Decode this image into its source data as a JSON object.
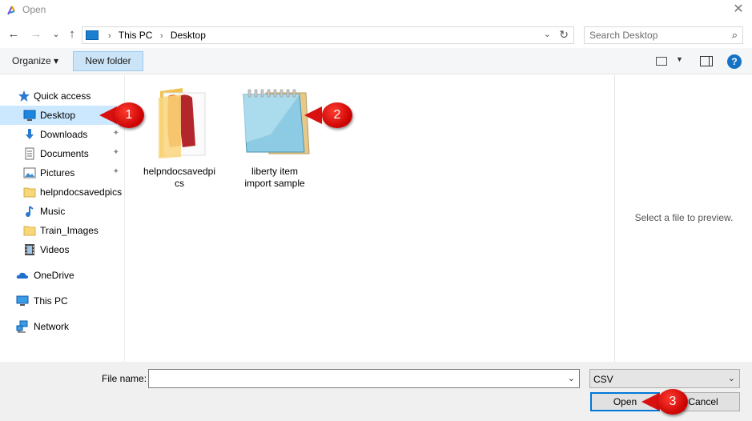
{
  "window": {
    "title": "Open",
    "close_glyph": "✕"
  },
  "navigation": {
    "back": "←",
    "forward": "→",
    "recent": "⌄",
    "up": "↑"
  },
  "address": {
    "breadcrumbs": [
      "This PC",
      "Desktop"
    ],
    "dropdown": "⌄",
    "refresh": "↻"
  },
  "search": {
    "placeholder": "Search Desktop"
  },
  "toolbar": {
    "organize_label": "Organize ▾",
    "new_folder_label": "New folder",
    "view_dropdown": "▼",
    "help": "?"
  },
  "sidebar": {
    "items": [
      {
        "label": "Quick access",
        "icon": "star-icon",
        "pinned": false
      },
      {
        "label": "Desktop",
        "icon": "desktop-icon",
        "pinned": true,
        "selected": true
      },
      {
        "label": "Downloads",
        "icon": "download-icon",
        "pinned": true
      },
      {
        "label": "Documents",
        "icon": "documents-icon",
        "pinned": true
      },
      {
        "label": "Pictures",
        "icon": "pictures-icon",
        "pinned": true
      },
      {
        "label": "helpndocsavedpics",
        "icon": "folder-icon",
        "pinned": false
      },
      {
        "label": "Music",
        "icon": "music-icon",
        "pinned": false
      },
      {
        "label": "Train_Images",
        "icon": "folder-icon",
        "pinned": false
      },
      {
        "label": "Videos",
        "icon": "videos-icon",
        "pinned": false
      },
      {
        "label": "OneDrive",
        "icon": "onedrive-icon",
        "pinned": false
      },
      {
        "label": "This PC",
        "icon": "this-pc-icon",
        "pinned": false
      },
      {
        "label": "Network",
        "icon": "network-icon",
        "pinned": false
      }
    ],
    "pin_glyph": "📌"
  },
  "files": [
    {
      "name_line1": "helpndocsavedpi",
      "name_line2": "cs",
      "type": "folder"
    },
    {
      "name_line1": "liberty item",
      "name_line2": "import sample",
      "type": "csv-notepad"
    }
  ],
  "preview": {
    "message": "Select a file to preview."
  },
  "footer": {
    "file_name_label": "File name:",
    "file_name_value": "",
    "file_type": "CSV",
    "dropdown": "⌄",
    "open_label": "Open",
    "cancel_label": "Cancel"
  },
  "callouts": [
    "1",
    "2",
    "3"
  ],
  "colors": {
    "accent": "#0078d7",
    "selection": "#cce8ff",
    "callout_red": "#d81010"
  }
}
